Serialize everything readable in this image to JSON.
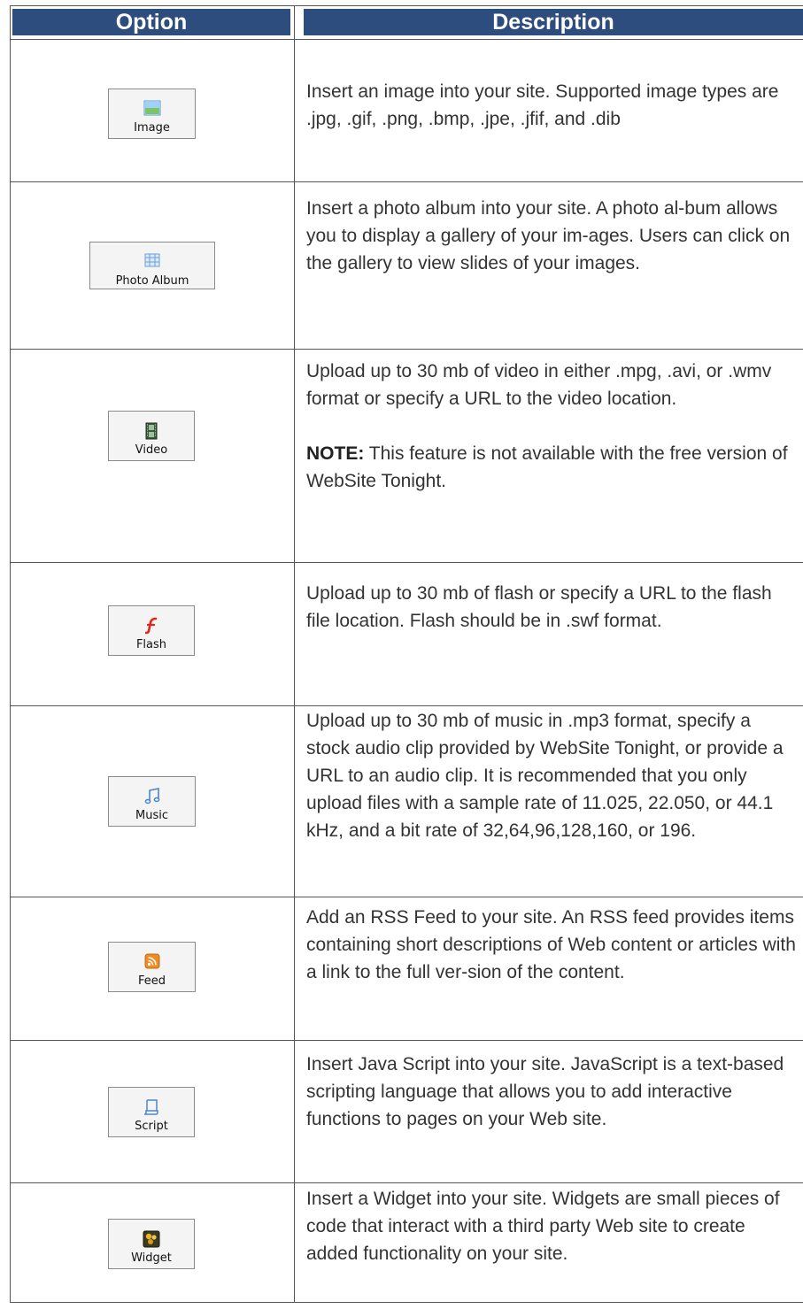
{
  "header": {
    "option": "Option",
    "description": "Description"
  },
  "rows": [
    {
      "label": "Image",
      "icon": "image-icon",
      "description": "Insert an image into your site. Supported image types are .jpg, .gif, .png, .bmp, .jpe, .jfif, and .dib"
    },
    {
      "label": "Photo Album",
      "icon": "photo-album-icon",
      "description": "Insert a photo album into your site. A photo al-bum allows you to display a gallery of your im-ages. Users can click on the gallery to view slides of your images."
    },
    {
      "label": "Video",
      "icon": "video-icon",
      "description": "Upload up to 30 mb of video in either .mpg, .avi, or .wmv format or specify a URL to the video location.",
      "note_label": "NOTE:",
      "note_text": " This feature is not available with the free version of WebSite Tonight."
    },
    {
      "label": "Flash",
      "icon": "flash-icon",
      "description": "Upload up to 30 mb of flash or specify a URL to the flash file location. Flash should be in .swf format."
    },
    {
      "label": "Music",
      "icon": "music-icon",
      "description": "Upload up to 30 mb of music in .mp3 format, specify a stock audio clip provided by WebSite Tonight, or provide a URL to an audio clip. It is recommended that you only upload files with a sample rate of 11.025, 22.050, or 44.1 kHz, and a bit rate of 32,64,96,128,160, or 196."
    },
    {
      "label": "Feed",
      "icon": "rss-feed-icon",
      "description": "Add an RSS Feed to your site. An RSS feed provides items containing short descriptions of Web content or articles with a link to the full ver-sion of the content."
    },
    {
      "label": "Script",
      "icon": "script-icon",
      "description": "Insert Java Script into your site. JavaScript is a text-based scripting language that allows you to add interactive functions to pages on your Web site."
    },
    {
      "label": "Widget",
      "icon": "widget-icon",
      "description": "Insert a Widget into your site. Widgets are small pieces of code that interact with a third party Web site to create added functionality on your site."
    }
  ],
  "colors": {
    "header_bg": "#2e4d7f",
    "header_text": "#ffffff"
  }
}
